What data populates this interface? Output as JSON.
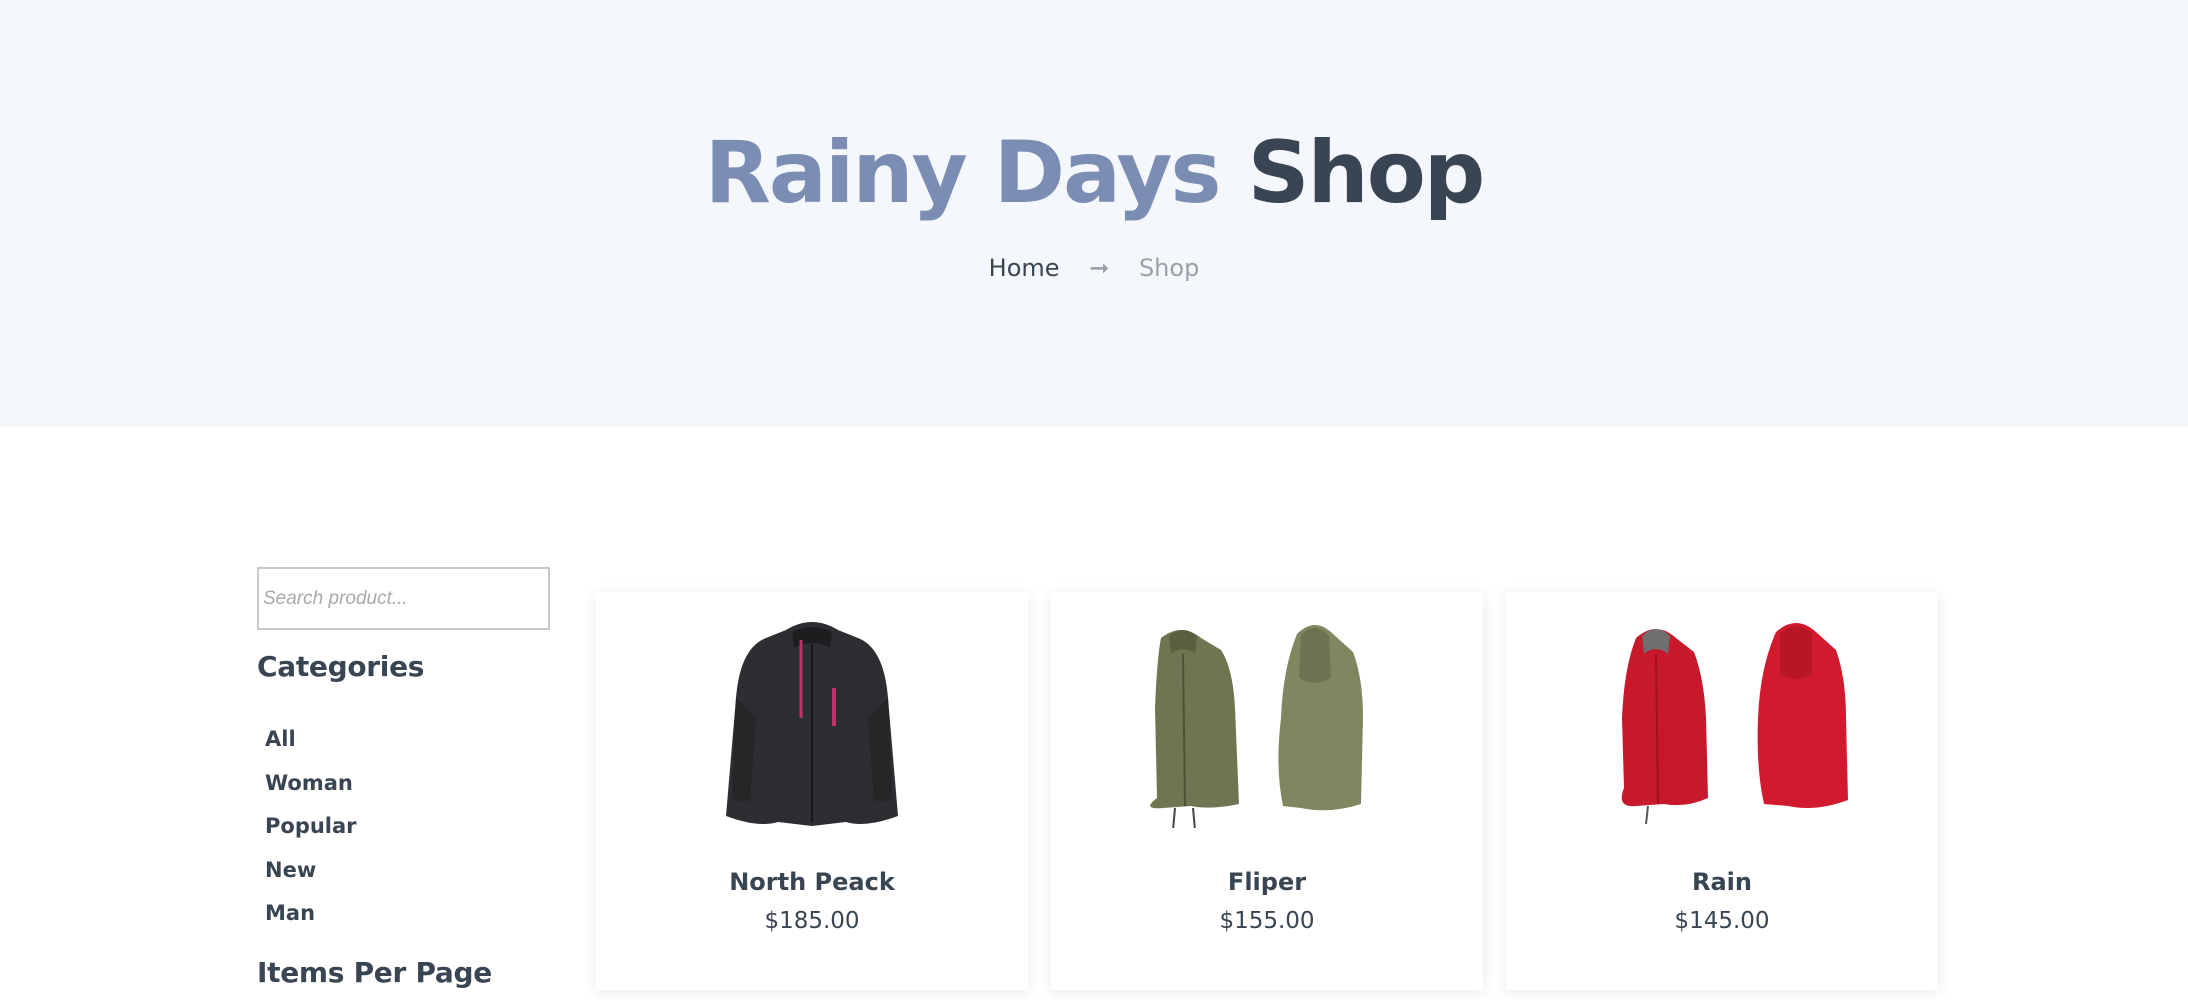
{
  "hero": {
    "title_accent": "Rainy Days",
    "title_main": "Shop",
    "breadcrumb": {
      "home": "Home",
      "arrow": "➞",
      "current": "Shop"
    }
  },
  "sidebar": {
    "search_placeholder": "Search product...",
    "categories_heading": "Categories",
    "categories": [
      "All",
      "Woman",
      "Popular",
      "New",
      "Man"
    ],
    "items_per_page_heading": "Items Per Page"
  },
  "products": [
    {
      "name": "North Peack",
      "price": "$185.00",
      "image": "dark-jacket-icon"
    },
    {
      "name": "Fliper",
      "price": "$155.00",
      "image": "olive-parka-icon"
    },
    {
      "name": "Rain",
      "price": "$145.00",
      "image": "red-coat-icon"
    }
  ],
  "colors": {
    "hero_bg": "#f4f8fd",
    "accent": "#7b8db3",
    "dark": "#3a4553"
  }
}
